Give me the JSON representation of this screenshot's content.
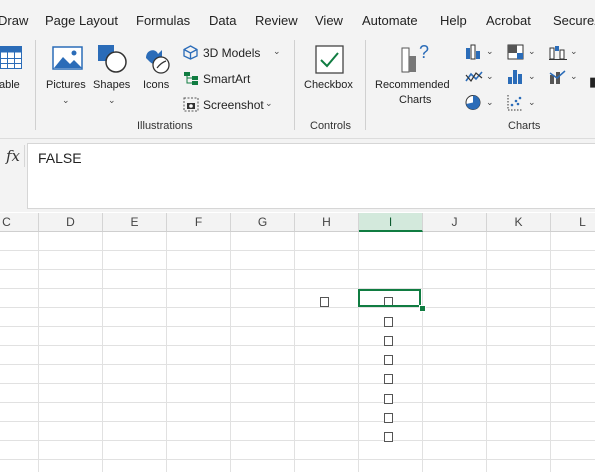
{
  "ribbon_tabs": [
    "Draw",
    "Page Layout",
    "Formulas",
    "Data",
    "Review",
    "View",
    "Automate",
    "Help",
    "Acrobat",
    "SecureZ"
  ],
  "ribbon": {
    "table_label": "able",
    "pictures_label": "Pictures",
    "shapes_label": "Shapes",
    "icons_label": "Icons",
    "models_3d_label": "3D Models",
    "smartart_label": "SmartArt",
    "screenshot_label": "Screenshot",
    "illustrations_group": "Illustrations",
    "checkbox_label": "Checkbox",
    "controls_group": "Controls",
    "recommended_charts_line1": "Recommended",
    "recommended_charts_line2": "Charts",
    "charts_group": "Charts"
  },
  "formula_bar": {
    "fx_label": "fx",
    "value": "FALSE"
  },
  "columns": [
    "C",
    "D",
    "E",
    "F",
    "G",
    "H",
    "I",
    "J",
    "K",
    "L"
  ],
  "selected_column": "I",
  "selected_cell_value": "FALSE",
  "checkboxes_checked": [
    false,
    false,
    false,
    false,
    false,
    false,
    false,
    false,
    false
  ],
  "colors": {
    "accent_green": "#107c41",
    "ribbon_bg": "#f3f3f3",
    "icon_blue": "#2b6cb8"
  }
}
